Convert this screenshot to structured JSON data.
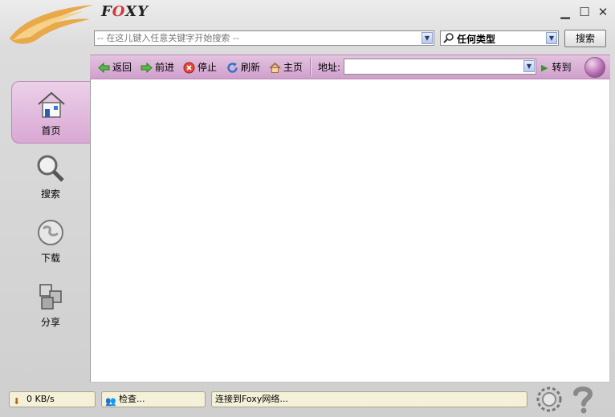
{
  "app": {
    "brand": "FOXY"
  },
  "search": {
    "placeholder": "-- 在这儿键入任意关键字开始搜索 --",
    "type_selected": "任何类型",
    "button_label": "搜索"
  },
  "nav": {
    "back": "返回",
    "forward": "前进",
    "stop": "停止",
    "refresh": "刷新",
    "home": "主页",
    "address_label": "地址:",
    "address_value": "",
    "goto": "转到"
  },
  "sidebar": {
    "items": [
      {
        "label": "首页",
        "icon": "home-icon",
        "active": true
      },
      {
        "label": "搜索",
        "icon": "magnifier-icon",
        "active": false
      },
      {
        "label": "下载",
        "icon": "globe-icon",
        "active": false
      },
      {
        "label": "分享",
        "icon": "cubes-icon",
        "active": false
      }
    ]
  },
  "status": {
    "speed": "0 KB/s",
    "check": "检查...",
    "connection": "连接到Foxy网络..."
  },
  "colors": {
    "accent": "#d9a8d4",
    "nav_bar": "#dbb2d7",
    "status_bg": "#f5f1d8"
  }
}
